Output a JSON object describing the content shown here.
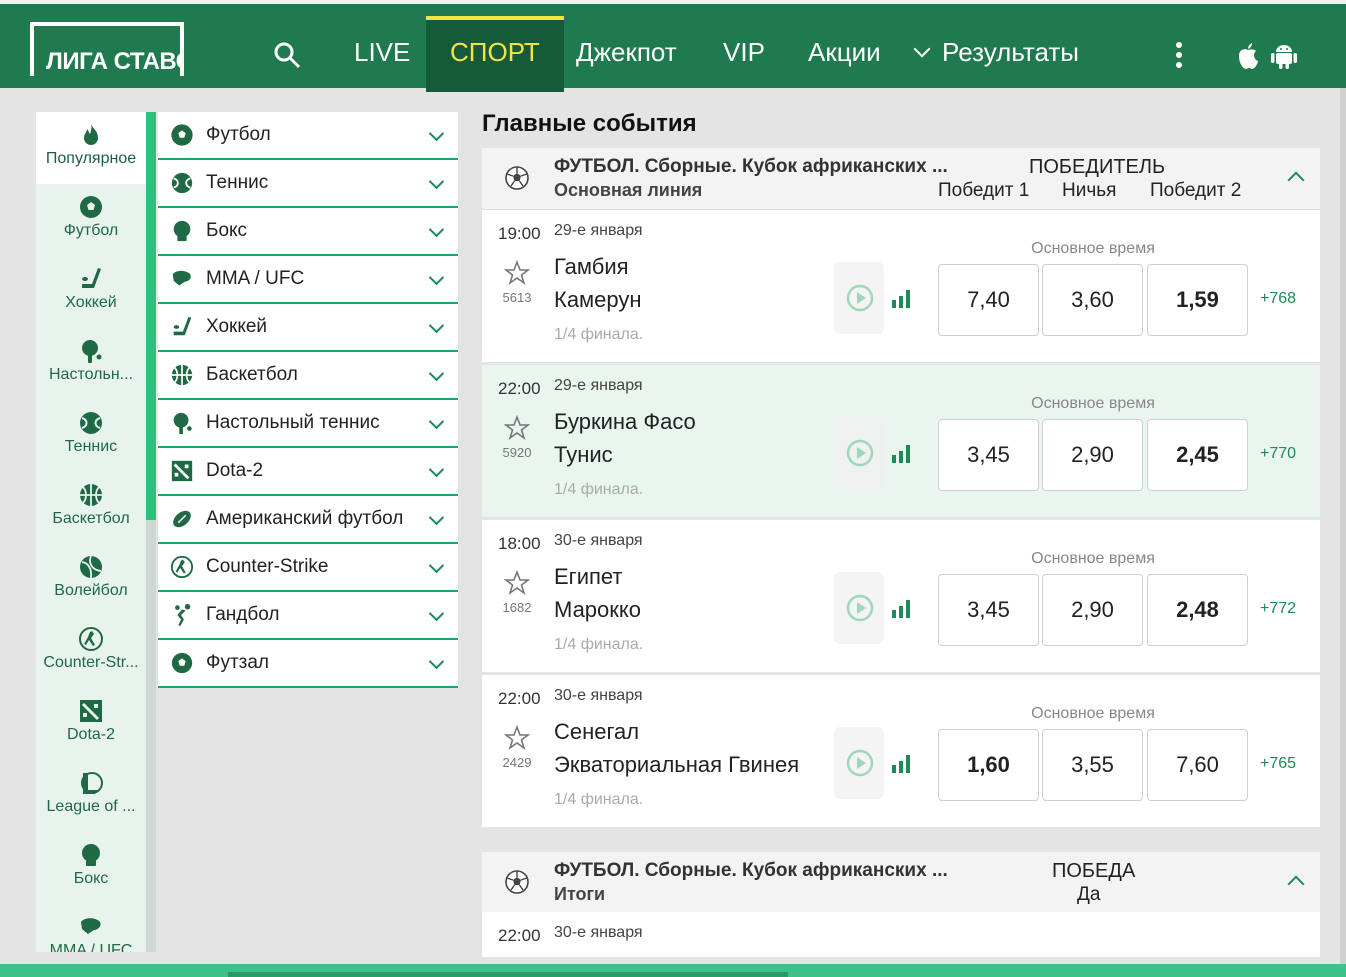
{
  "header": {
    "logo": "ЛИГА СТАВОК",
    "nav": [
      {
        "label": "LIVE"
      },
      {
        "label": "СПОРТ",
        "active": true
      },
      {
        "label": "Джекпот"
      },
      {
        "label": "VIP"
      },
      {
        "label": "Акции"
      },
      {
        "label": "Результаты"
      }
    ],
    "icons": [
      "search-icon",
      "more-vertical-icon",
      "apple-icon",
      "android-icon"
    ]
  },
  "icon_sidebar": [
    {
      "label": "Популярное",
      "icon": "fire-icon",
      "active": true
    },
    {
      "label": "Футбол",
      "icon": "football-icon"
    },
    {
      "label": "Хоккей",
      "icon": "hockey-icon"
    },
    {
      "label": "Настольн...",
      "icon": "table-tennis-icon"
    },
    {
      "label": "Теннис",
      "icon": "tennis-icon"
    },
    {
      "label": "Баскетбол",
      "icon": "basketball-icon"
    },
    {
      "label": "Волейбол",
      "icon": "volleyball-icon"
    },
    {
      "label": "Counter-Str...",
      "icon": "counter-strike-icon"
    },
    {
      "label": "Dota-2",
      "icon": "dota-icon"
    },
    {
      "label": "League of ...",
      "icon": "league-of-legends-icon"
    },
    {
      "label": "Бокс",
      "icon": "boxing-icon"
    },
    {
      "label": "MMA / UFC",
      "icon": "mma-icon"
    }
  ],
  "sport_list": [
    {
      "label": "Футбол",
      "icon": "football-icon"
    },
    {
      "label": "Теннис",
      "icon": "tennis-icon"
    },
    {
      "label": "Бокс",
      "icon": "boxing-icon"
    },
    {
      "label": "MMA / UFC",
      "icon": "mma-icon"
    },
    {
      "label": "Хоккей",
      "icon": "hockey-icon"
    },
    {
      "label": "Баскетбол",
      "icon": "basketball-icon"
    },
    {
      "label": "Настольный теннис",
      "icon": "table-tennis-icon"
    },
    {
      "label": "Dota-2",
      "icon": "dota-icon"
    },
    {
      "label": "Американский футбол",
      "icon": "american-football-icon"
    },
    {
      "label": "Counter-Strike",
      "icon": "counter-strike-icon"
    },
    {
      "label": "Гандбол",
      "icon": "handball-icon"
    },
    {
      "label": "Футзал",
      "icon": "futsal-icon"
    }
  ],
  "main": {
    "title": "Главные события",
    "section1": {
      "title": "ФУТБОЛ. Сборные. Кубок африканских ...",
      "subtitle": "Основная линия",
      "market": "ПОБЕДИТЕЛЬ",
      "cols": [
        "Победит 1",
        "Ничья",
        "Победит 2"
      ],
      "events": [
        {
          "time": "19:00",
          "date": "29-е января",
          "count": "5613",
          "team1": "Гамбия",
          "team2": "Камерун",
          "stage": "1/4 финала.",
          "basis": "Основное время",
          "odds": [
            "7,40",
            "3,60",
            "1,59"
          ],
          "best": 2,
          "more": "+768"
        },
        {
          "time": "22:00",
          "date": "29-е января",
          "count": "5920",
          "team1": "Буркина Фасо",
          "team2": "Тунис",
          "stage": "1/4 финала.",
          "basis": "Основное время",
          "odds": [
            "3,45",
            "2,90",
            "2,45"
          ],
          "best": 2,
          "more": "+770"
        },
        {
          "time": "18:00",
          "date": "30-е января",
          "count": "1682",
          "team1": "Египет",
          "team2": "Марокко",
          "stage": "1/4 финала.",
          "basis": "Основное время",
          "odds": [
            "3,45",
            "2,90",
            "2,48"
          ],
          "best": 2,
          "more": "+772"
        },
        {
          "time": "22:00",
          "date": "30-е января",
          "count": "2429",
          "team1": "Сенегал",
          "team2": "Экваториальная Гвинея",
          "stage": "1/4 финала.",
          "basis": "Основное время",
          "odds": [
            "1,60",
            "3,55",
            "7,60"
          ],
          "best": 0,
          "more": "+765"
        }
      ]
    },
    "section2": {
      "title": "ФУТБОЛ. Сборные. Кубок африканских ...",
      "subtitle": "Итоги",
      "market": "ПОБЕДА",
      "col": "Да",
      "partial_time": "22:00",
      "partial_date": "30-е января"
    }
  },
  "colors": {
    "header": "#1f7a4f",
    "active_nav": "#155a39",
    "accent_yellow": "#f5e342",
    "green": "#23a468"
  }
}
